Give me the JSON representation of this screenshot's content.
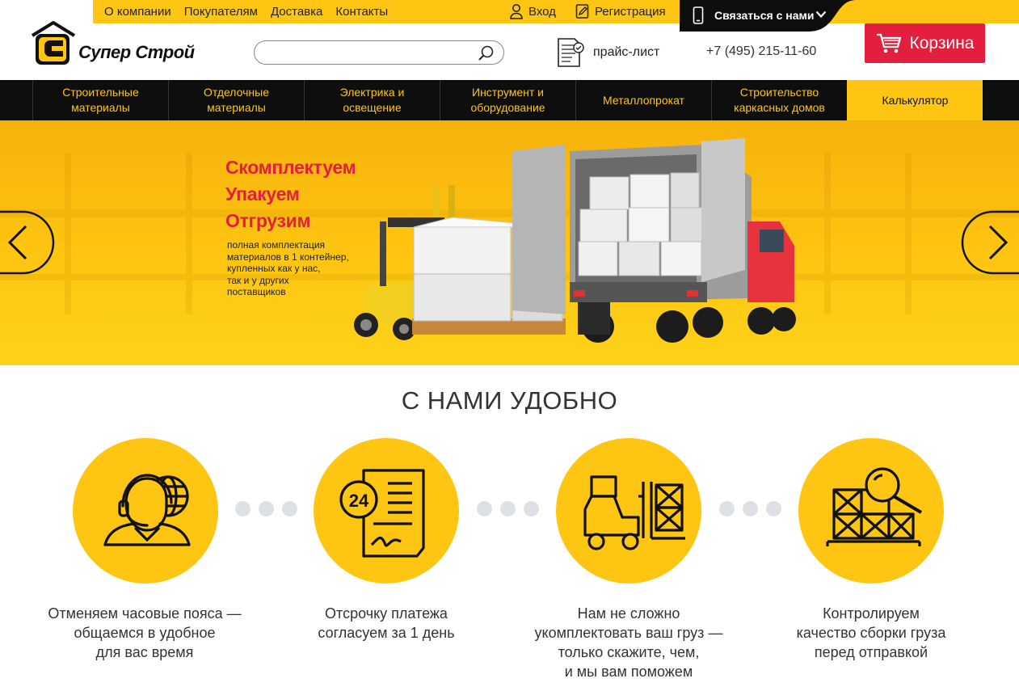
{
  "topmenu": {
    "items": [
      "О компании",
      "Покупателям",
      "Доставка",
      "Контакты"
    ],
    "login": "Вход",
    "register": "Регистрация",
    "contact_us": "Связаться с нами"
  },
  "logo": {
    "text": "Супер Строй"
  },
  "search": {
    "value": "",
    "placeholder": ""
  },
  "header": {
    "price_list": "прайс-лист",
    "phone": "+7 (495) 215-11-60",
    "cart": "Корзина"
  },
  "nav": {
    "items": [
      {
        "line1": "Строительные",
        "line2": "материалы"
      },
      {
        "line1": "Отделочные",
        "line2": "материалы"
      },
      {
        "line1": "Электрика и",
        "line2": "освещение"
      },
      {
        "line1": "Инструмент и",
        "line2": "оборудование"
      },
      {
        "line1": "Металлопрокат",
        "line2": ""
      },
      {
        "line1": "Строительство",
        "line2": "каркасных домов"
      },
      {
        "line1": "Калькулятор",
        "line2": ""
      }
    ]
  },
  "hero": {
    "headline": [
      "Скомплектуем",
      "Упакуем",
      "Отгрузим"
    ],
    "subtext": [
      "полная комплектация",
      "материалов в 1 контейнер,",
      "купленных как у нас,",
      "так и у других",
      "поставщиков"
    ]
  },
  "section": {
    "title": "С НАМИ УДОБНО"
  },
  "features": [
    {
      "icon": "operator-globe-icon",
      "lines": [
        "Отменяем часовые пояса —",
        "общаемся в удобное",
        "для вас время"
      ]
    },
    {
      "icon": "document-24-icon",
      "lines": [
        "Отсрочку платежа",
        "согласуем за 1 день"
      ]
    },
    {
      "icon": "forklift-icon",
      "lines": [
        "Нам не сложно",
        "укомплектовать ваш груз —",
        "только скажите, чем,",
        "и мы вам поможем"
      ]
    },
    {
      "icon": "crates-magnifier-icon",
      "lines": [
        "Контролируем",
        "качество сборки груза",
        "перед отправкой"
      ]
    }
  ],
  "colors": {
    "accent": "#fec613",
    "dark": "#0e0e0e",
    "cart": "#e41f3d",
    "headline": "#e41f3d"
  }
}
